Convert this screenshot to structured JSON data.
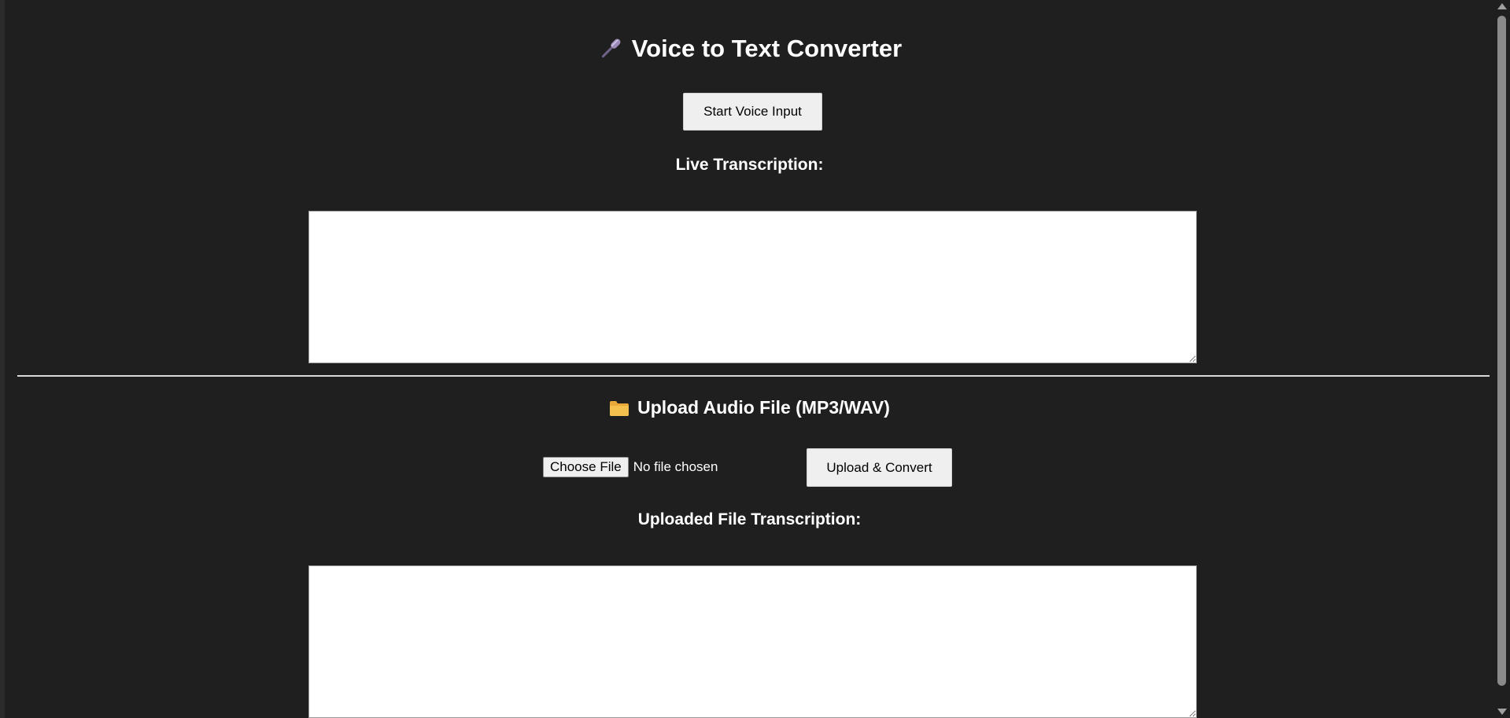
{
  "header": {
    "title": "Voice to Text Converter",
    "icon": "microphone-icon"
  },
  "voice": {
    "start_button": "Start Voice Input",
    "live_label": "Live Transcription:",
    "live_text": ""
  },
  "upload": {
    "title": "Upload Audio File (MP3/WAV)",
    "icon": "folder-icon",
    "choose_file": "Choose File",
    "file_status": "No file chosen",
    "convert_button": "Upload & Convert",
    "uploaded_label": "Uploaded File Transcription:",
    "uploaded_text": ""
  },
  "colors": {
    "background": "#1f1f1f",
    "text": "#ffffff",
    "button": "#efefef",
    "folder": "#f4c04e",
    "microphone": "#9b8ab5"
  }
}
